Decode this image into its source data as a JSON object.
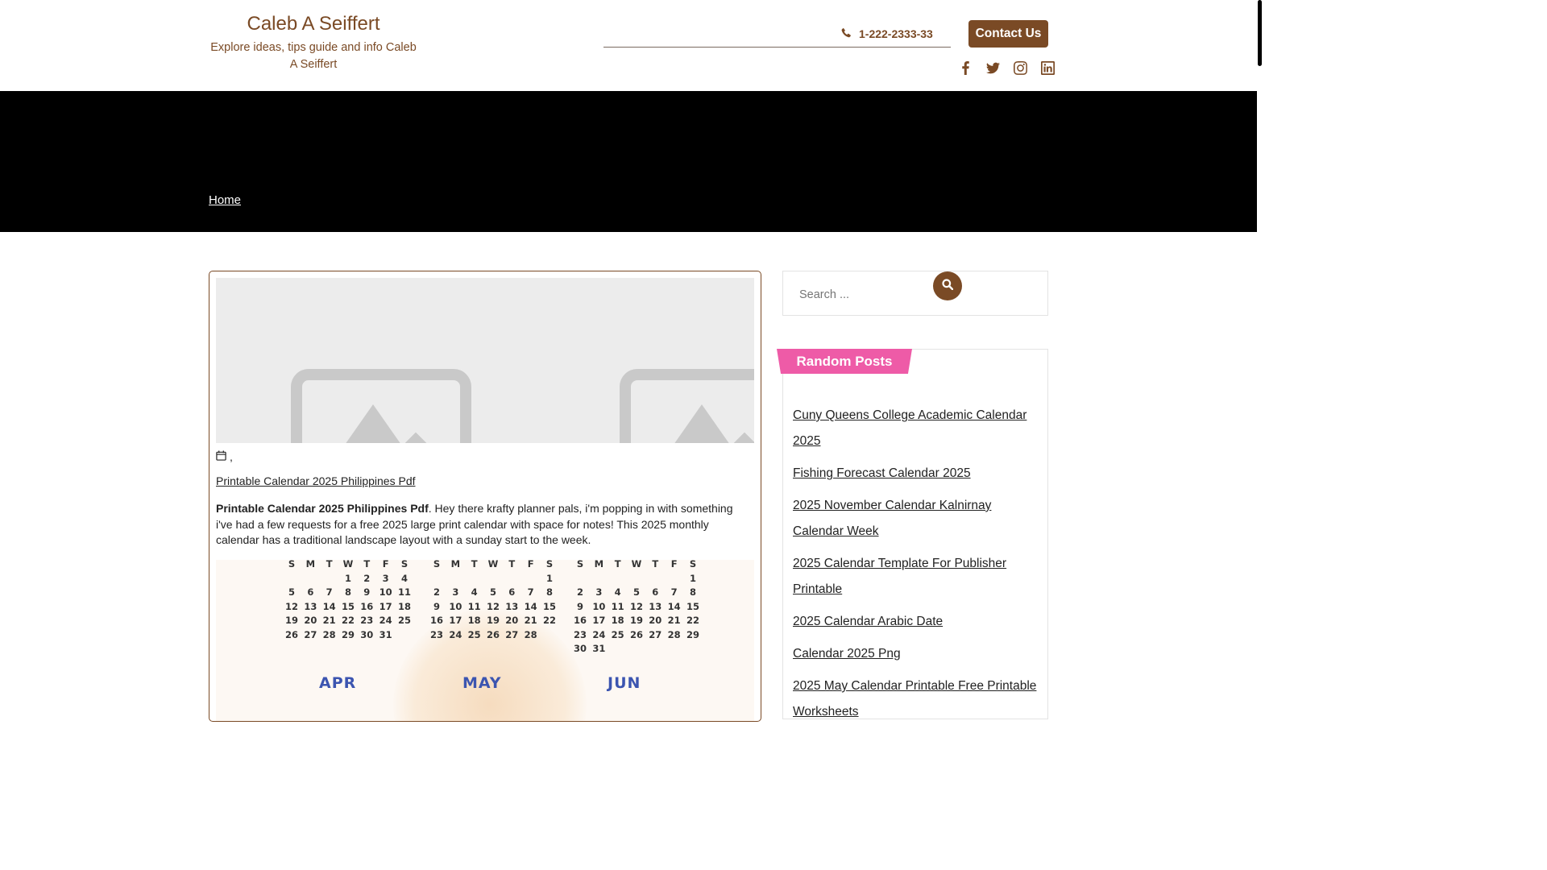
{
  "site": {
    "title": "Caleb A Seiffert",
    "tagline": "Explore ideas, tips guide and info Caleb A Seiffert",
    "phone": "1-222-2333-33",
    "contact_label": "Contact Us",
    "socials": [
      "facebook-icon",
      "twitter-icon",
      "instagram-icon",
      "linkedin-icon"
    ]
  },
  "nav": {
    "home_label": "Home"
  },
  "article": {
    "meta_separator": ",",
    "post_title": "Printable Calendar 2025 Philippines Pdf",
    "excerpt_bold": "Printable Calendar 2025 Philippines Pdf",
    "excerpt_rest": ". Hey there krafty planner pals, i'm popping in with something i've had a few requests for a free 2025 large print calendar with space for notes! This 2025 monthly calendar has a traditional landscape layout with a sunday start to the week.",
    "calendar_image": {
      "weekday_header": [
        "S",
        "M",
        "T",
        "W",
        "T",
        "F",
        "S"
      ],
      "months_top": [
        {
          "rows": [
            [
              "",
              "",
              "",
              "1",
              "2",
              "3",
              "4"
            ],
            [
              "5",
              "6",
              "7",
              "8",
              "9",
              "10",
              "11"
            ],
            [
              "12",
              "13",
              "14",
              "15",
              "16",
              "17",
              "18"
            ],
            [
              "19",
              "20",
              "21",
              "22",
              "23",
              "24",
              "25"
            ],
            [
              "26",
              "27",
              "28",
              "29",
              "30",
              "31",
              ""
            ]
          ]
        },
        {
          "rows": [
            [
              "",
              "",
              "",
              "",
              "",
              "",
              "1"
            ],
            [
              "2",
              "3",
              "4",
              "5",
              "6",
              "7",
              "8"
            ],
            [
              "9",
              "10",
              "11",
              "12",
              "13",
              "14",
              "15"
            ],
            [
              "16",
              "17",
              "18",
              "19",
              "20",
              "21",
              "22"
            ],
            [
              "23",
              "24",
              "25",
              "26",
              "27",
              "28",
              ""
            ]
          ]
        },
        {
          "rows": [
            [
              "",
              "",
              "",
              "",
              "",
              "",
              "1"
            ],
            [
              "2",
              "3",
              "4",
              "5",
              "6",
              "7",
              "8"
            ],
            [
              "9",
              "10",
              "11",
              "12",
              "13",
              "14",
              "15"
            ],
            [
              "16",
              "17",
              "18",
              "19",
              "20",
              "21",
              "22"
            ],
            [
              "23",
              "24",
              "25",
              "26",
              "27",
              "28",
              "29"
            ],
            [
              "30",
              "31",
              "",
              "",
              "",
              "",
              ""
            ]
          ]
        }
      ],
      "month_labels_bottom": [
        "APR",
        "MAY",
        "JUN"
      ]
    }
  },
  "sidebar": {
    "search_placeholder": "Search ...",
    "random_posts_title": "Random Posts",
    "random_posts": [
      "Cuny Queens College Academic Calendar 2025",
      "Fishing Forecast Calendar 2025",
      "2025 November Calendar Kalnirnay Calendar Week",
      "2025 Calendar Template For Publisher Printable",
      "2025 Calendar Arabic Date",
      "Calendar 2025 Png",
      "2025 May Calendar Printable Free Printable Worksheets"
    ]
  },
  "colors": {
    "brand": "#7a4a25",
    "accent_pink": "#ee5ba7",
    "nav_bg": "#000000",
    "month_label": "#3c55b0"
  }
}
